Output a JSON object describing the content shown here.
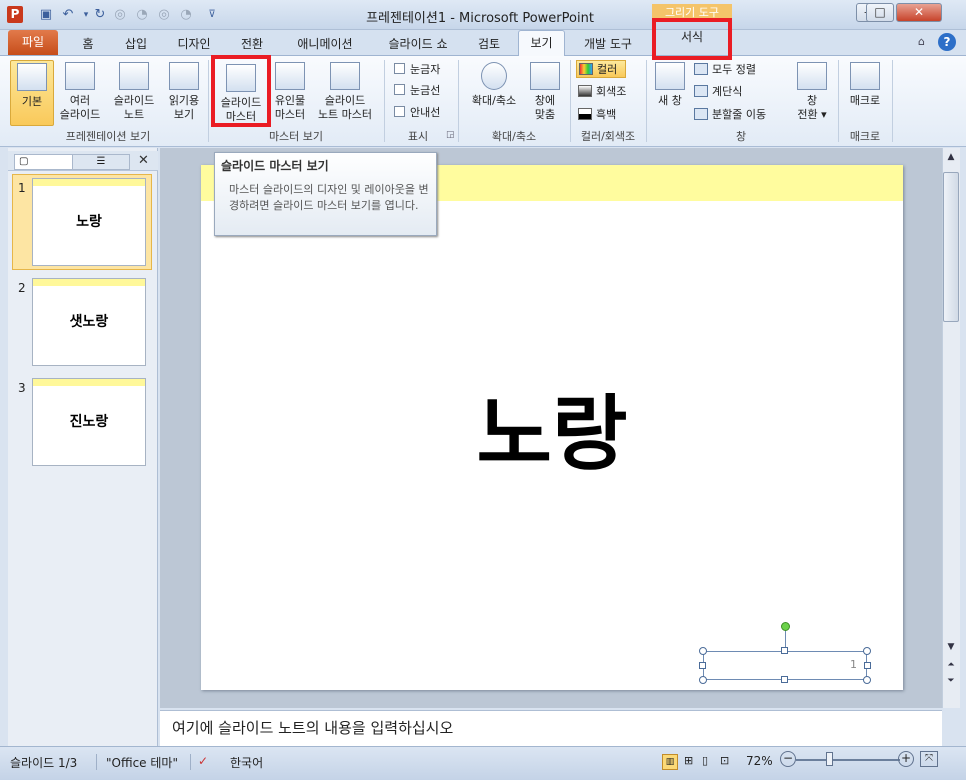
{
  "window": {
    "title": "프레젠테이션1 - Microsoft PowerPoint",
    "app_icon": "P",
    "context_header": "그리기 도구",
    "controls": {
      "minimize": "—",
      "maximize": "□",
      "close": "✕"
    }
  },
  "quick_access": [
    "save-icon",
    "undo-icon",
    "redo-icon"
  ],
  "tabs": {
    "file": "파일",
    "home": "홈",
    "insert": "삽입",
    "design": "디자인",
    "transitions": "전환",
    "animations": "애니메이션",
    "slideshow": "슬라이드 쇼",
    "review": "검토",
    "view": "보기",
    "developer": "개발 도구",
    "format": "서식"
  },
  "ribbon": {
    "presentation_views": {
      "label": "프레젠테이션 보기",
      "normal": "기본",
      "slide_sorter": "여러\n슬라이드",
      "notes_page": "슬라이드\n노트",
      "reading_view": "읽기용\n보기"
    },
    "master_views": {
      "label": "마스터 보기",
      "slide_master": "슬라이드\n마스터",
      "handout_master": "유인물\n마스터",
      "notes_master": "슬라이드\n노트 마스터"
    },
    "show": {
      "label": "표시",
      "ruler": "눈금자",
      "gridlines": "눈금선",
      "guides": "안내선"
    },
    "zoom": {
      "label": "확대/축소",
      "zoom": "확대/축소",
      "fit": "창에\n맞춤"
    },
    "color": {
      "label": "컬러/회색조",
      "color": "컬러",
      "grayscale": "회색조",
      "bw": "흑백"
    },
    "window": {
      "label": "창",
      "new_window": "새 창",
      "arrange_all": "모두 정렬",
      "cascade": "계단식",
      "move_split": "분할줄 이동",
      "switch_windows": "창\n전환 ▾"
    },
    "macros": {
      "label": "매크로",
      "macros": "매크로"
    }
  },
  "tooltip": {
    "title": "슬라이드 마스터 보기",
    "description": "마스터 슬라이드의 디자인 및 레이아웃을 변경하려면 슬라이드 마스터 보기를 엽니다."
  },
  "slides": [
    {
      "num": "1",
      "title": "노랑"
    },
    {
      "num": "2",
      "title": "샛노랑"
    },
    {
      "num": "3",
      "title": "진노랑"
    }
  ],
  "current_slide": {
    "title": "노랑",
    "page_number": "1"
  },
  "notes_placeholder": "여기에 슬라이드 노트의 내용을 입력하십시오",
  "status": {
    "slide": "슬라이드 1/3",
    "theme": "\"Office 테마\"",
    "language": "한국어",
    "zoom": "72%"
  }
}
